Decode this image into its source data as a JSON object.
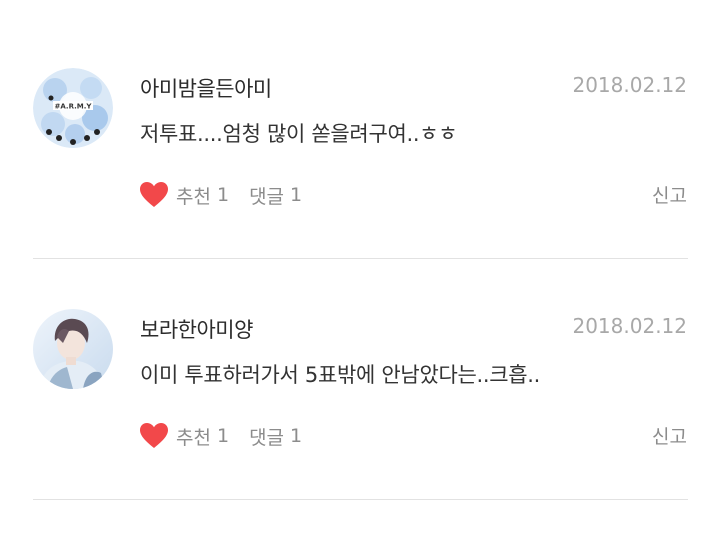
{
  "comments": [
    {
      "nickname": "아미밤을든아미",
      "date": "2018.02.12",
      "text": "저투표....엄청 많이 쏟을려구여..ㅎㅎ",
      "like_label": "추천",
      "like_count": "1",
      "reply_label": "댓글",
      "reply_count": "1",
      "report_label": "신고",
      "avatar_icon": "army-bomb-avatar",
      "avatar_text": "#A.R.M.Y"
    },
    {
      "nickname": "보라한아미양",
      "date": "2018.02.12",
      "text": "이미 투표하러가서 5표밖에 안남았다는..크흡..",
      "like_label": "추천",
      "like_count": "1",
      "reply_label": "댓글",
      "reply_count": "1",
      "report_label": "신고",
      "avatar_icon": "person-photo-avatar"
    }
  ],
  "colors": {
    "heart": "#f2484a",
    "nickname": "#2b2b2b",
    "date": "#a8a8a8",
    "meta": "#8c8c8c",
    "divider": "#e2e2e2"
  }
}
